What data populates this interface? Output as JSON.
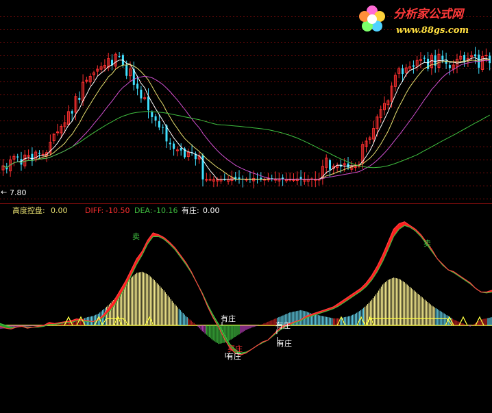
{
  "watermark": {
    "cn": "分析家公式网",
    "url": "www.88gs.com"
  },
  "price_panel": {
    "low_label": "7.80",
    "ma_colors": {
      "ma5": "#ffffff",
      "ma10": "#e8e070",
      "ma20": "#d050d0",
      "ma60": "#40c040"
    },
    "candle_up": "#ff3030",
    "candle_down": "#40e0ff"
  },
  "indicator_bar": {
    "gdkp_label": "高度控盘:",
    "gdkp_value": "0.00",
    "diff_label": "DIFF:",
    "diff_value": "-10.50",
    "dea_label": "DEA:",
    "dea_value": "-10.16",
    "yz_label": "有庄:",
    "yz_value": "0.00",
    "colors": {
      "gdkp": "#e8e070",
      "diff": "#ff3030",
      "dea": "#40c040",
      "yz": "#ffffff"
    }
  },
  "annotations": {
    "sell1": "卖",
    "sell2": "卖",
    "buy1": "买庄",
    "youzhuang": "有庄"
  },
  "chart_data": {
    "type": "line",
    "title": "",
    "series": [
      {
        "name": "DIFF",
        "values": [
          -1,
          -3,
          -4,
          -2,
          -1,
          -3,
          -2,
          -1,
          0,
          3,
          2,
          3,
          4,
          5,
          7,
          6,
          5,
          4,
          6,
          12,
          20,
          28,
          38,
          48,
          60,
          72,
          80,
          92,
          100,
          98,
          95,
          90,
          84,
          76,
          68,
          58,
          46,
          34,
          20,
          8,
          -2,
          -14,
          -24,
          -30,
          -32,
          -30,
          -26,
          -22,
          -18,
          -16,
          -10,
          -4,
          0,
          2,
          4,
          6,
          10,
          12,
          14,
          16,
          18,
          20,
          24,
          28,
          32,
          36,
          40,
          46,
          54,
          64,
          76,
          90,
          104,
          110,
          112,
          108,
          104,
          98,
          90,
          82,
          72,
          66,
          60,
          58,
          54,
          50,
          46,
          40,
          36,
          36,
          38
        ]
      },
      {
        "name": "DEA",
        "values": [
          2,
          0,
          -2,
          -2,
          -1,
          -2,
          -2,
          -2,
          -1,
          1,
          1,
          2,
          3,
          3,
          5,
          5,
          4,
          4,
          5,
          9,
          15,
          22,
          32,
          42,
          54,
          66,
          76,
          88,
          96,
          96,
          93,
          88,
          82,
          74,
          66,
          57,
          46,
          35,
          22,
          11,
          1,
          -10,
          -20,
          -26,
          -30,
          -29,
          -26,
          -22,
          -19,
          -16,
          -11,
          -6,
          -2,
          0,
          3,
          5,
          8,
          10,
          12,
          14,
          16,
          18,
          21,
          25,
          29,
          33,
          37,
          42,
          49,
          58,
          69,
          82,
          96,
          104,
          108,
          106,
          102,
          96,
          88,
          80,
          72,
          65,
          60,
          57,
          53,
          49,
          45,
          40,
          36,
          35,
          36
        ]
      }
    ],
    "hist": [
      -6,
      -5,
      -4,
      -3,
      -2,
      -2,
      -1,
      -1,
      1,
      2,
      2,
      3,
      4,
      6,
      9,
      11,
      14,
      16,
      20,
      28,
      36,
      46,
      58,
      70,
      82,
      90,
      92,
      88,
      80,
      70,
      60,
      48,
      36,
      26,
      16,
      8,
      0,
      -10,
      -18,
      -26,
      -32,
      -30,
      -26,
      -20,
      -14,
      -8,
      -4,
      -1,
      2,
      6,
      10,
      14,
      18,
      22,
      24,
      26,
      24,
      20,
      18,
      16,
      14,
      12,
      12,
      14,
      16,
      20,
      26,
      34,
      44,
      56,
      70,
      78,
      82,
      80,
      74,
      66,
      58,
      50,
      42,
      34,
      28,
      22,
      16,
      10,
      6,
      2,
      -2,
      4,
      10,
      12,
      14
    ],
    "price": {
      "low": 7.8,
      "ma_periods": [
        5,
        10,
        20,
        60
      ]
    }
  }
}
